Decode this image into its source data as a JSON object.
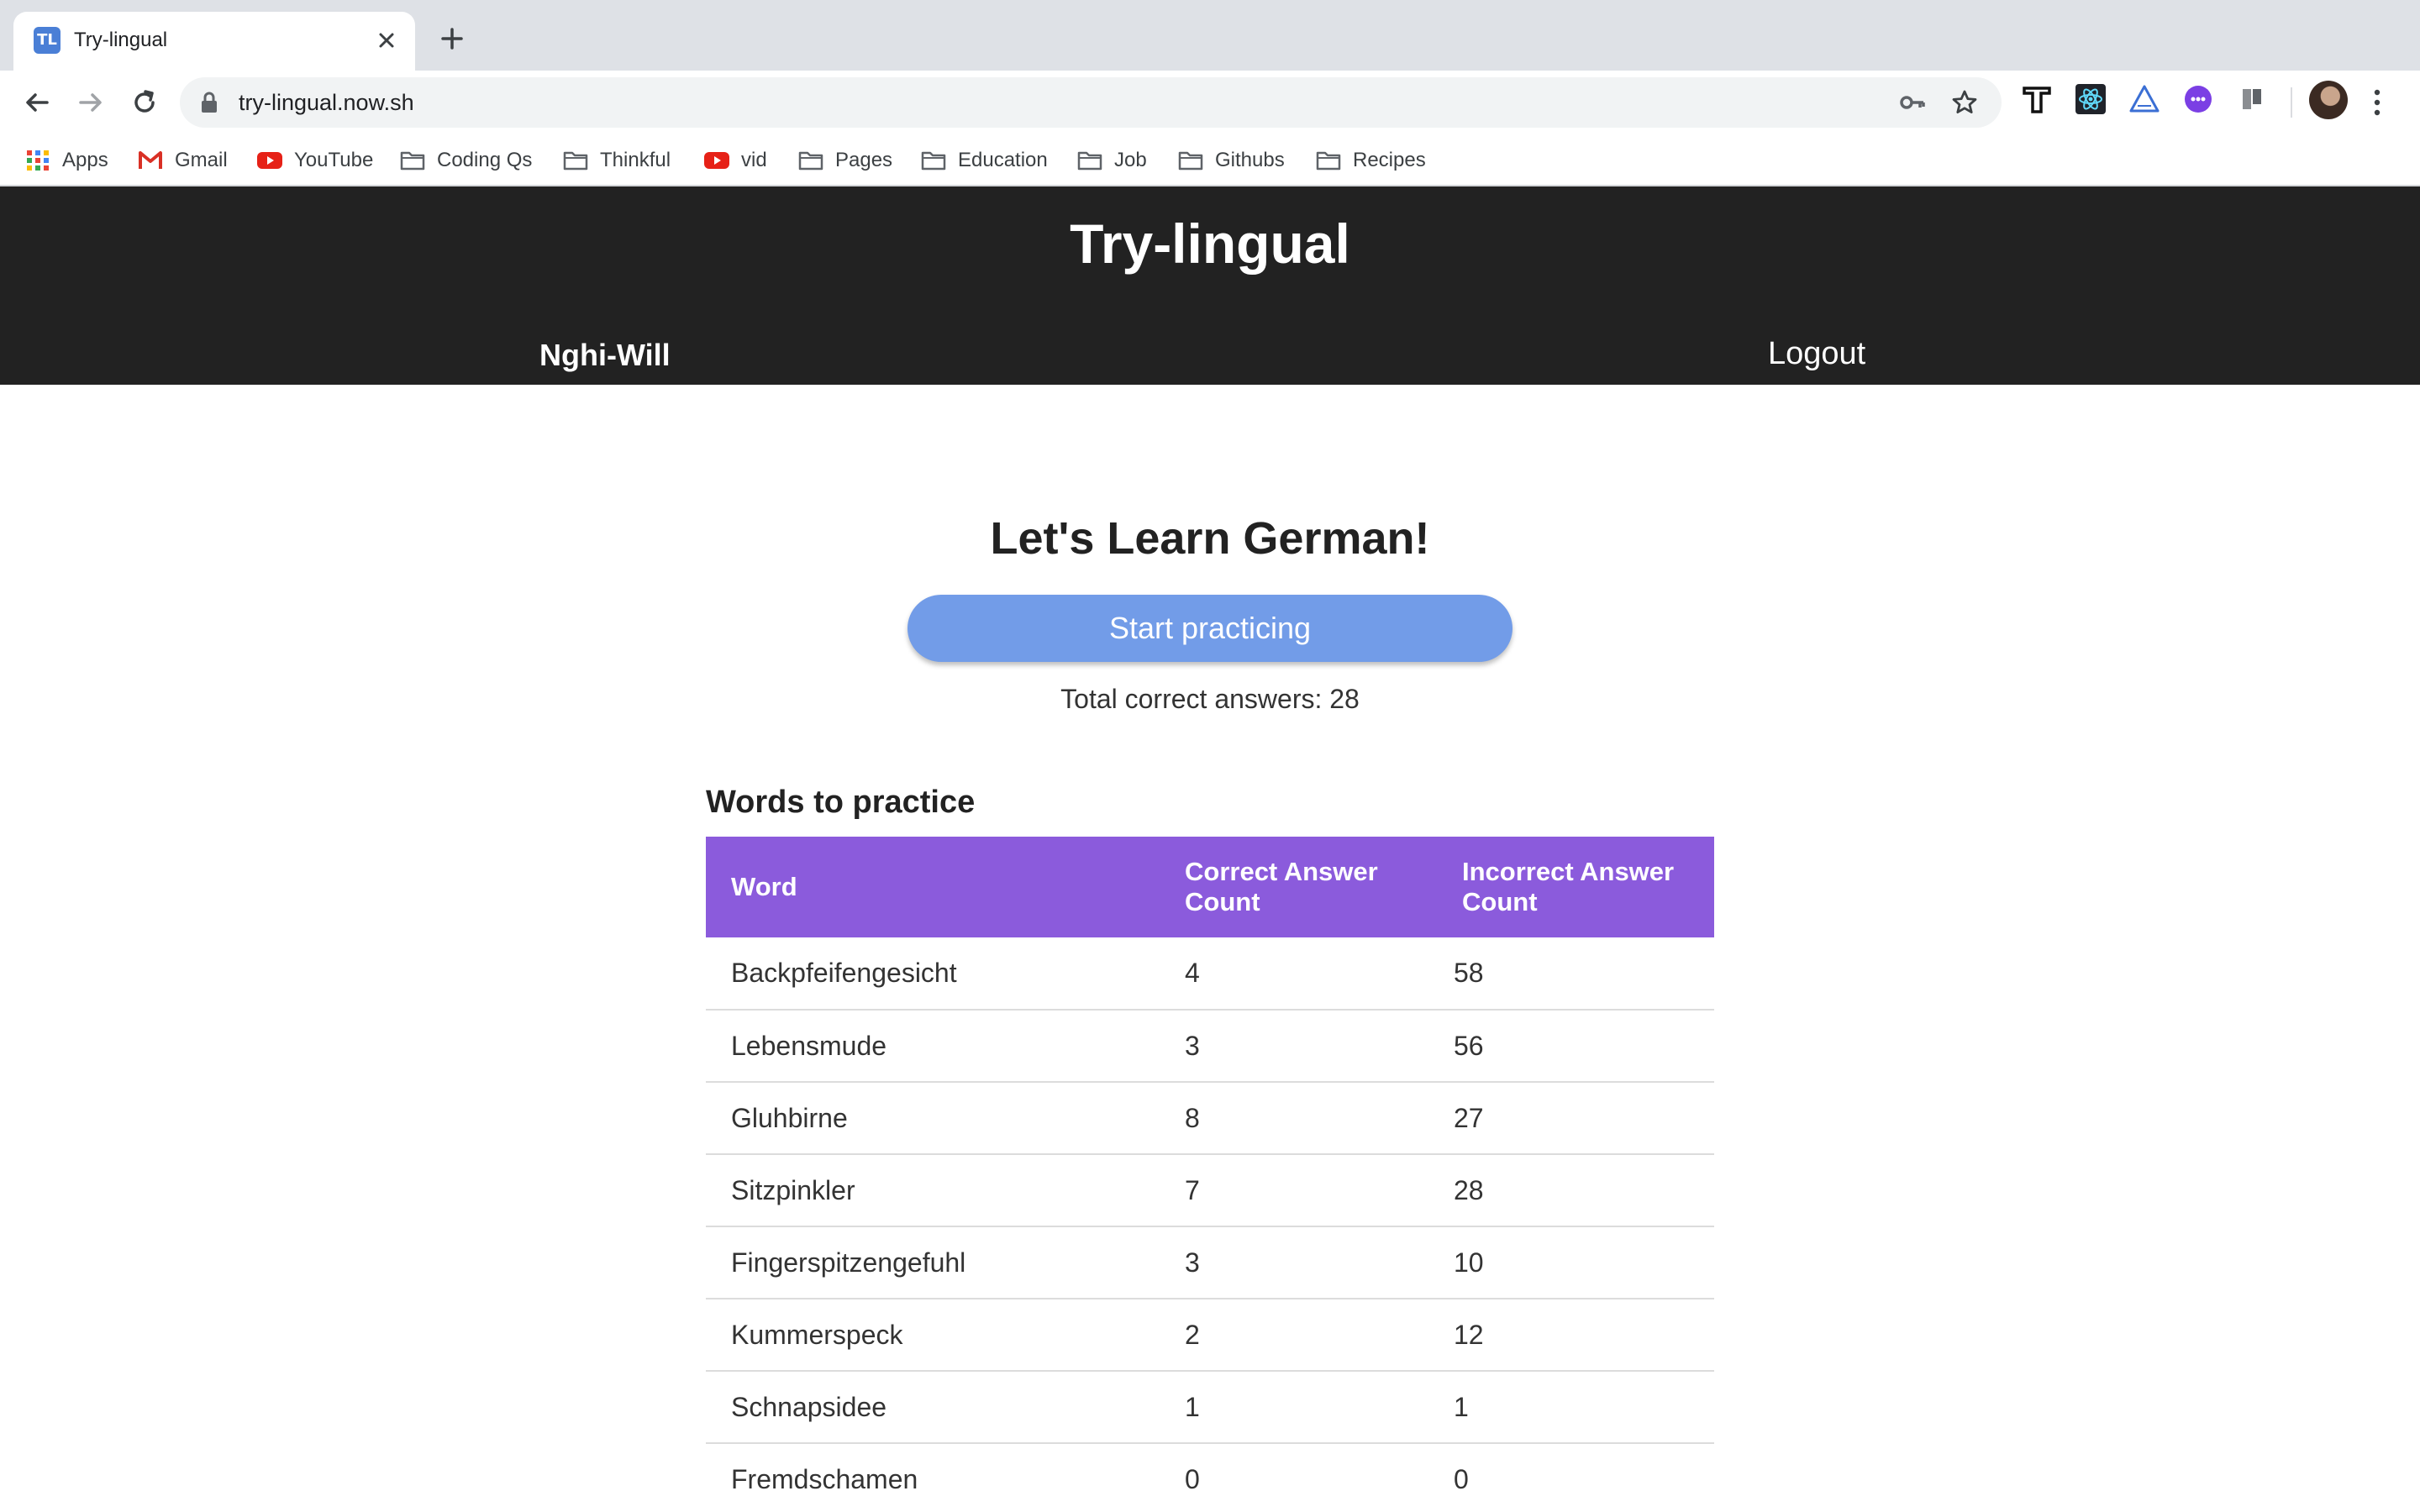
{
  "browser": {
    "tab_title": "Try-lingual",
    "tab_favicon_text": "TL",
    "url": "try-lingual.now.sh",
    "bookmarks": [
      {
        "label": "Apps",
        "icon": "apps-grid-icon"
      },
      {
        "label": "Gmail",
        "icon": "gmail-icon"
      },
      {
        "label": "YouTube",
        "icon": "youtube-icon"
      },
      {
        "label": "Coding Qs",
        "icon": "folder-icon"
      },
      {
        "label": "Thinkful",
        "icon": "folder-icon"
      },
      {
        "label": "vid",
        "icon": "youtube-icon"
      },
      {
        "label": "Pages",
        "icon": "folder-icon"
      },
      {
        "label": "Education",
        "icon": "folder-icon"
      },
      {
        "label": "Job",
        "icon": "folder-icon"
      },
      {
        "label": "Githubs",
        "icon": "folder-icon"
      },
      {
        "label": "Recipes",
        "icon": "folder-icon"
      }
    ]
  },
  "header": {
    "title": "Try-lingual",
    "username": "Nghi-Will",
    "logout_label": "Logout"
  },
  "main": {
    "heading": "Let's Learn German!",
    "start_button_label": "Start practicing",
    "total_correct": "Total correct answers: 28"
  },
  "words": {
    "heading": "Words to practice",
    "columns": [
      "Word",
      "Correct Answer Count",
      "Incorrect Answer Count"
    ],
    "rows": [
      {
        "word": "Backpfeifengesicht",
        "correct": "4",
        "incorrect": "58"
      },
      {
        "word": "Lebensmude",
        "correct": "3",
        "incorrect": "56"
      },
      {
        "word": "Gluhbirne",
        "correct": "8",
        "incorrect": "27"
      },
      {
        "word": "Sitzpinkler",
        "correct": "7",
        "incorrect": "28"
      },
      {
        "word": "Fingerspitzengefuhl",
        "correct": "3",
        "incorrect": "10"
      },
      {
        "word": "Kummerspeck",
        "correct": "2",
        "incorrect": "12"
      },
      {
        "word": "Schnapsidee",
        "correct": "1",
        "incorrect": "1"
      },
      {
        "word": "Fremdschamen",
        "correct": "0",
        "incorrect": "0"
      }
    ]
  },
  "colors": {
    "header_bg": "#222222",
    "button_bg": "#729ce8",
    "table_header_bg": "#8b5bdc"
  }
}
